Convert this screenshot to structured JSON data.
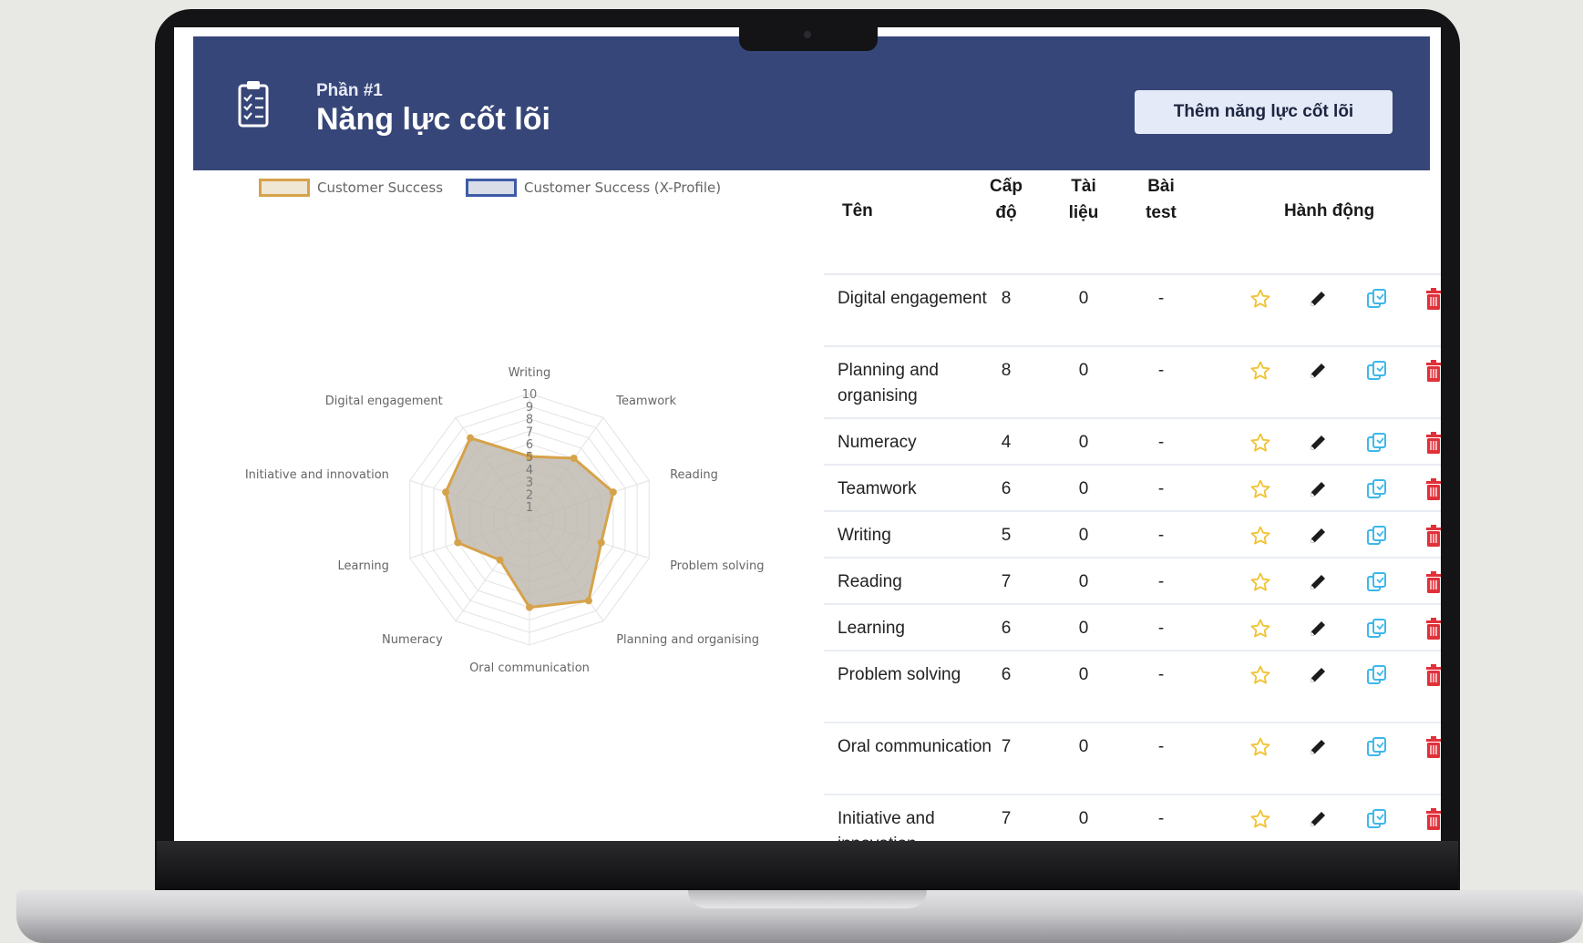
{
  "header": {
    "section_label": "Phần #1",
    "title": "Năng lực cốt lõi",
    "add_button": "Thêm năng lực cốt lõi"
  },
  "legend": [
    {
      "label": "Customer Success",
      "fill": "#efe6d4",
      "stroke": "#d6a24a"
    },
    {
      "label": "Customer Success (X-Profile)",
      "fill": "#d9dde8",
      "stroke": "#3f5aa6"
    }
  ],
  "chart_data": {
    "type": "radar",
    "axes": [
      "Writing",
      "Teamwork",
      "Reading",
      "Problem solving",
      "Planning and organising",
      "Oral communication",
      "Numeracy",
      "Learning",
      "Initiative and innovation",
      "Digital engagement"
    ],
    "scale_ticks": [
      "1",
      "2",
      "3",
      "4",
      "5",
      "6",
      "7",
      "8",
      "9",
      "10"
    ],
    "rlim": [
      0,
      10
    ],
    "series": [
      {
        "name": "Customer Success",
        "values": [
          5,
          6,
          7,
          6,
          8,
          7,
          4,
          6,
          7,
          8
        ],
        "color": "#d6a24a",
        "fill": "#bbb6ac"
      }
    ]
  },
  "table": {
    "headers": {
      "name": "Tên",
      "level_1": "Cấp",
      "level_2": "độ",
      "docs_1": "Tài",
      "docs_2": "liệu",
      "test_1": "Bài",
      "test_2": "test",
      "actions": "Hành động"
    },
    "rows": [
      {
        "name": "Digital engagement",
        "level": "8",
        "docs": "0",
        "test": "-"
      },
      {
        "name": "Planning and organising",
        "level": "8",
        "docs": "0",
        "test": "-"
      },
      {
        "name": "Numeracy",
        "level": "4",
        "docs": "0",
        "test": "-"
      },
      {
        "name": "Teamwork",
        "level": "6",
        "docs": "0",
        "test": "-"
      },
      {
        "name": "Writing",
        "level": "5",
        "docs": "0",
        "test": "-"
      },
      {
        "name": "Reading",
        "level": "7",
        "docs": "0",
        "test": "-"
      },
      {
        "name": "Learning",
        "level": "6",
        "docs": "0",
        "test": "-"
      },
      {
        "name": "Problem solving",
        "level": "6",
        "docs": "0",
        "test": "-"
      },
      {
        "name": "Oral communication",
        "level": "7",
        "docs": "0",
        "test": "-"
      },
      {
        "name": "Initiative and innovation",
        "level": "7",
        "docs": "0",
        "test": "-"
      }
    ]
  },
  "colors": {
    "header_bg": "#374678",
    "star": "#f1c232",
    "edit": "#1c1c1c",
    "copy": "#3db7ea",
    "delete": "#e0313a"
  }
}
